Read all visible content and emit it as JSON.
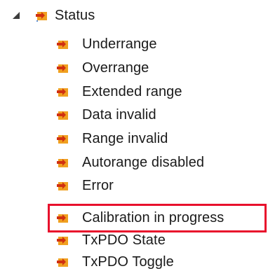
{
  "tree": {
    "parent": {
      "label": "Status",
      "expander_icon": "collapse-triangle-icon",
      "icon": "variable-input-icon",
      "expanded": true
    },
    "children": [
      {
        "label": "Underrange",
        "icon": "variable-input-icon"
      },
      {
        "label": "Overrange",
        "icon": "variable-input-icon"
      },
      {
        "label": "Extended range",
        "icon": "variable-input-icon"
      },
      {
        "label": "Data invalid",
        "icon": "variable-input-icon"
      },
      {
        "label": "Range invalid",
        "icon": "variable-input-icon"
      },
      {
        "label": "Autorange disabled",
        "icon": "variable-input-icon"
      },
      {
        "label": "Error",
        "icon": "variable-input-icon"
      },
      {
        "label": "Calibration in progress",
        "icon": "variable-input-icon",
        "highlighted": true
      },
      {
        "label": "TxPDO State",
        "icon": "variable-input-icon"
      },
      {
        "label": "TxPDO Toggle",
        "icon": "variable-input-icon"
      }
    ]
  },
  "colors": {
    "icon_body": "#f0a020",
    "icon_accent": "#d03010",
    "highlight": "#e8102c"
  }
}
